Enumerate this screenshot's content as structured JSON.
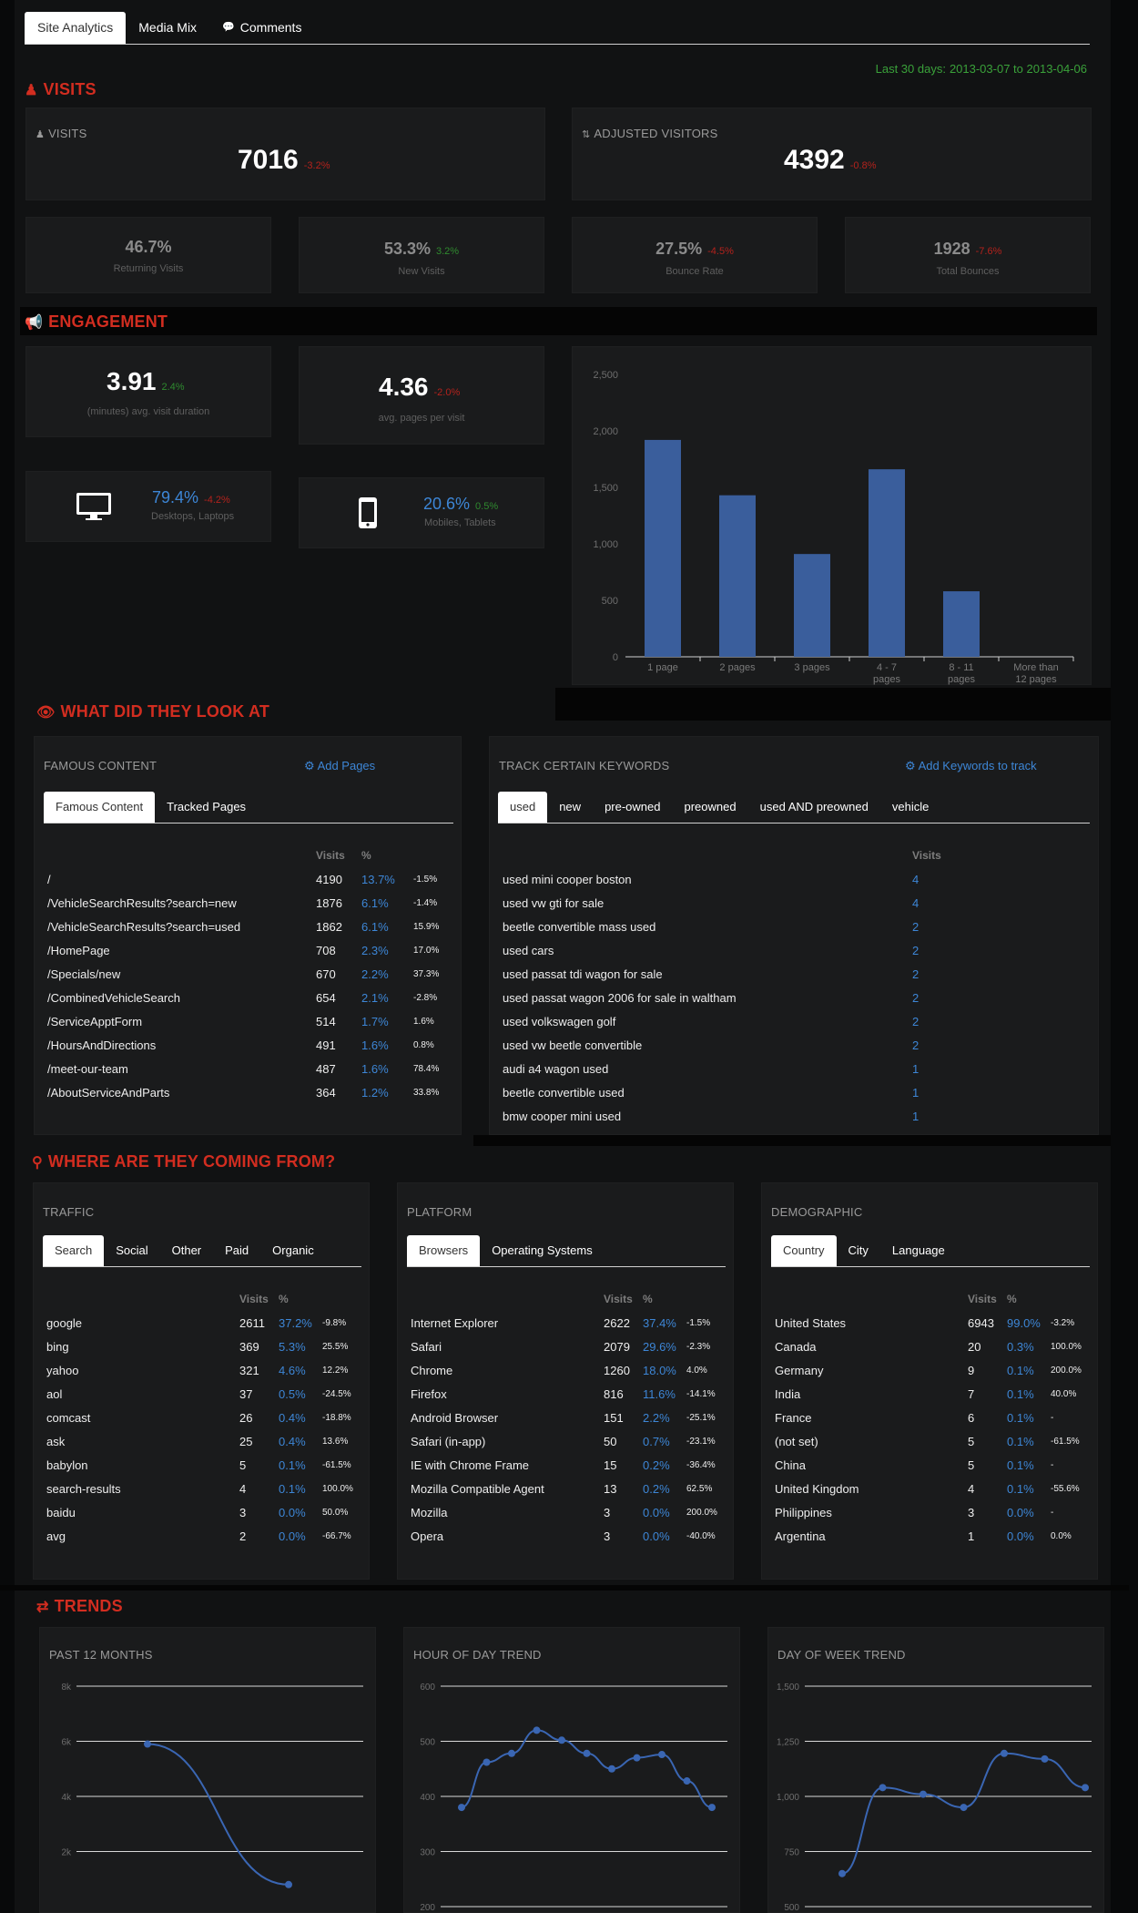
{
  "tabs": [
    "Site Analytics",
    "Media Mix",
    "Comments"
  ],
  "date_range": {
    "label": "Last 30 days:",
    "range": "2013-03-07 to 2013-04-06"
  },
  "visits": {
    "title": "VISITS",
    "visits_label": "VISITS",
    "visits_value": "7016",
    "visits_delta": "-3.2%",
    "adjusted_label": "ADJUSTED VISITORS",
    "adjusted_value": "4392",
    "adjusted_delta": "-0.8%",
    "stats": [
      {
        "value": "46.7%",
        "delta": "",
        "label": "Returning Visits",
        "tone": "neg"
      },
      {
        "value": "53.3%",
        "delta": "3.2%",
        "label": "New Visits",
        "tone": "pos"
      },
      {
        "value": "27.5%",
        "delta": "-4.5%",
        "label": "Bounce Rate",
        "tone": "neg"
      },
      {
        "value": "1928",
        "delta": "-7.6%",
        "label": "Total Bounces",
        "tone": "neg"
      }
    ]
  },
  "engagement": {
    "title": "ENGAGEMENT",
    "duration_value": "3.91",
    "duration_delta": "2.4%",
    "duration_label": "(minutes) avg. visit duration",
    "pages_value": "4.36",
    "pages_delta": "-2.0%",
    "pages_label": "avg. pages per visit",
    "desktop_value": "79.4%",
    "desktop_delta": "-4.2%",
    "desktop_label": "Desktops, Laptops",
    "mobile_value": "20.6%",
    "mobile_delta": "0.5%",
    "mobile_label": "Mobiles, Tablets",
    "desktop_icon": "monitor-icon",
    "mobile_icon": "phone-icon"
  },
  "chart_data": [
    {
      "type": "bar",
      "categories": [
        "1 page",
        "2 pages",
        "3 pages",
        "4 - 7 pages",
        "8 - 11 pages",
        "More than 12 pages"
      ],
      "category_lines": [
        [
          "1 page"
        ],
        [
          "2 pages"
        ],
        [
          "3 pages"
        ],
        [
          "4 - 7",
          "pages"
        ],
        [
          "8 - 11",
          "pages"
        ],
        [
          "More than",
          "12 pages"
        ]
      ],
      "values": [
        1920,
        1430,
        910,
        1660,
        580,
        0
      ],
      "yticks": [
        "0",
        "500",
        "1,000",
        "1,500",
        "2,000",
        "2,500"
      ],
      "ylim": [
        0,
        2500
      ],
      "title": "",
      "xlabel": "",
      "ylabel": "",
      "grid": false,
      "color": "#3a5e9c"
    },
    {
      "type": "line",
      "title": "PAST 12 MONTHS",
      "x": [
        1,
        2
      ],
      "values": [
        5900,
        800
      ],
      "yticks": [
        "2k",
        "4k",
        "6k",
        "8k"
      ],
      "ylim": [
        0,
        8000
      ],
      "grid": true
    },
    {
      "type": "line",
      "title": "HOUR OF DAY TREND",
      "values": [
        380,
        462,
        478,
        520,
        502,
        478,
        450,
        470,
        476,
        428,
        380
      ],
      "yticks": [
        "200",
        "300",
        "400",
        "500",
        "600"
      ],
      "ylim": [
        200,
        600
      ],
      "grid": true
    },
    {
      "type": "line",
      "title": "DAY OF WEEK TREND",
      "values": [
        650,
        1040,
        1010,
        950,
        1195,
        1170,
        1040
      ],
      "yticks": [
        "500",
        "750",
        "1,000",
        "1,250",
        "1,500"
      ],
      "ylim": [
        500,
        1500
      ],
      "grid": true
    }
  ],
  "look": {
    "title": "WHAT DID THEY LOOK AT",
    "famous": {
      "title": "FAMOUS CONTENT",
      "add_label": "Add Pages",
      "tabs": [
        "Famous Content",
        "Tracked Pages"
      ],
      "headers": [
        "Visits",
        "%"
      ],
      "rows": [
        {
          "page": "/",
          "visits": "4190",
          "pct": "13.7%",
          "delta": "-1.5%",
          "tone": "neg"
        },
        {
          "page": "/VehicleSearchResults?search=new",
          "visits": "1876",
          "pct": "6.1%",
          "delta": "-1.4%",
          "tone": "neg"
        },
        {
          "page": "/VehicleSearchResults?search=used",
          "visits": "1862",
          "pct": "6.1%",
          "delta": "15.9%",
          "tone": "pos"
        },
        {
          "page": "/HomePage",
          "visits": "708",
          "pct": "2.3%",
          "delta": "17.0%",
          "tone": "pos"
        },
        {
          "page": "/Specials/new",
          "visits": "670",
          "pct": "2.2%",
          "delta": "37.3%",
          "tone": "pos"
        },
        {
          "page": "/CombinedVehicleSearch",
          "visits": "654",
          "pct": "2.1%",
          "delta": "-2.8%",
          "tone": "neg"
        },
        {
          "page": "/ServiceApptForm",
          "visits": "514",
          "pct": "1.7%",
          "delta": "1.6%",
          "tone": "pos"
        },
        {
          "page": "/HoursAndDirections",
          "visits": "491",
          "pct": "1.6%",
          "delta": "0.8%",
          "tone": "pos"
        },
        {
          "page": "/meet-our-team",
          "visits": "487",
          "pct": "1.6%",
          "delta": "78.4%",
          "tone": "pos"
        },
        {
          "page": "/AboutServiceAndParts",
          "visits": "364",
          "pct": "1.2%",
          "delta": "33.8%",
          "tone": "pos"
        }
      ]
    },
    "keywords": {
      "title": "TRACK CERTAIN KEYWORDS",
      "add_label": "Add Keywords to track",
      "tabs": [
        "used",
        "new",
        "pre-owned",
        "preowned",
        "used AND preowned",
        "vehicle"
      ],
      "header": "Visits",
      "rows": [
        {
          "kw": "used mini cooper boston",
          "visits": "4"
        },
        {
          "kw": "used vw gti for sale",
          "visits": "4"
        },
        {
          "kw": "beetle convertible mass used",
          "visits": "2"
        },
        {
          "kw": "used cars",
          "visits": "2"
        },
        {
          "kw": "used passat tdi wagon for sale",
          "visits": "2"
        },
        {
          "kw": "used passat wagon 2006 for sale in waltham",
          "visits": "2"
        },
        {
          "kw": "used volkswagen golf",
          "visits": "2"
        },
        {
          "kw": "used vw beetle convertible",
          "visits": "2"
        },
        {
          "kw": "audi a4 wagon used",
          "visits": "1"
        },
        {
          "kw": "beetle convertible used",
          "visits": "1"
        },
        {
          "kw": "bmw cooper mini used",
          "visits": "1"
        }
      ]
    }
  },
  "coming": {
    "title": "WHERE ARE THEY COMING FROM?",
    "traffic": {
      "title": "TRAFFIC",
      "tabs": [
        "Search",
        "Social",
        "Other",
        "Paid",
        "Organic"
      ],
      "headers": [
        "Visits",
        "%"
      ],
      "rows": [
        {
          "name": "google",
          "visits": "2611",
          "pct": "37.2%",
          "delta": "-9.8%",
          "tone": "neg"
        },
        {
          "name": "bing",
          "visits": "369",
          "pct": "5.3%",
          "delta": "25.5%",
          "tone": "pos"
        },
        {
          "name": "yahoo",
          "visits": "321",
          "pct": "4.6%",
          "delta": "12.2%",
          "tone": "pos"
        },
        {
          "name": "aol",
          "visits": "37",
          "pct": "0.5%",
          "delta": "-24.5%",
          "tone": "neg"
        },
        {
          "name": "comcast",
          "visits": "26",
          "pct": "0.4%",
          "delta": "-18.8%",
          "tone": "neg"
        },
        {
          "name": "ask",
          "visits": "25",
          "pct": "0.4%",
          "delta": "13.6%",
          "tone": "pos"
        },
        {
          "name": "babylon",
          "visits": "5",
          "pct": "0.1%",
          "delta": "-61.5%",
          "tone": "neg"
        },
        {
          "name": "search-results",
          "visits": "4",
          "pct": "0.1%",
          "delta": "100.0%",
          "tone": "pos"
        },
        {
          "name": "baidu",
          "visits": "3",
          "pct": "0.0%",
          "delta": "50.0%",
          "tone": "pos"
        },
        {
          "name": "avg",
          "visits": "2",
          "pct": "0.0%",
          "delta": "-66.7%",
          "tone": "neg"
        }
      ]
    },
    "platform": {
      "title": "PLATFORM",
      "tabs": [
        "Browsers",
        "Operating Systems"
      ],
      "headers": [
        "Visits",
        "%"
      ],
      "rows": [
        {
          "name": "Internet Explorer",
          "visits": "2622",
          "pct": "37.4%",
          "delta": "-1.5%",
          "tone": "neg"
        },
        {
          "name": "Safari",
          "visits": "2079",
          "pct": "29.6%",
          "delta": "-2.3%",
          "tone": "neg"
        },
        {
          "name": "Chrome",
          "visits": "1260",
          "pct": "18.0%",
          "delta": "4.0%",
          "tone": "pos"
        },
        {
          "name": "Firefox",
          "visits": "816",
          "pct": "11.6%",
          "delta": "-14.1%",
          "tone": "neg"
        },
        {
          "name": "Android Browser",
          "visits": "151",
          "pct": "2.2%",
          "delta": "-25.1%",
          "tone": "neg"
        },
        {
          "name": "Safari (in-app)",
          "visits": "50",
          "pct": "0.7%",
          "delta": "-23.1%",
          "tone": "neg"
        },
        {
          "name": "IE with Chrome Frame",
          "visits": "15",
          "pct": "0.2%",
          "delta": "-36.4%",
          "tone": "pos"
        },
        {
          "name": "Mozilla Compatible Agent",
          "visits": "13",
          "pct": "0.2%",
          "delta": "62.5%",
          "tone": "pos"
        },
        {
          "name": "Mozilla",
          "visits": "3",
          "pct": "0.0%",
          "delta": "200.0%",
          "tone": "pos"
        },
        {
          "name": "Opera",
          "visits": "3",
          "pct": "0.0%",
          "delta": "-40.0%",
          "tone": "neg"
        }
      ]
    },
    "demographic": {
      "title": "DEMOGRAPHIC",
      "tabs": [
        "Country",
        "City",
        "Language"
      ],
      "headers": [
        "Visits",
        "%"
      ],
      "rows": [
        {
          "name": "United States",
          "visits": "6943",
          "pct": "99.0%",
          "delta": "-3.2%",
          "tone": "neg"
        },
        {
          "name": "Canada",
          "visits": "20",
          "pct": "0.3%",
          "delta": "100.0%",
          "tone": "pos"
        },
        {
          "name": "Germany",
          "visits": "9",
          "pct": "0.1%",
          "delta": "200.0%",
          "tone": "pos"
        },
        {
          "name": "India",
          "visits": "7",
          "pct": "0.1%",
          "delta": "40.0%",
          "tone": "pos"
        },
        {
          "name": "France",
          "visits": "6",
          "pct": "0.1%",
          "delta": "-",
          "tone": "pos"
        },
        {
          "name": "(not set)",
          "visits": "5",
          "pct": "0.1%",
          "delta": "-61.5%",
          "tone": "neg"
        },
        {
          "name": "China",
          "visits": "5",
          "pct": "0.1%",
          "delta": "-",
          "tone": "pos"
        },
        {
          "name": "United Kingdom",
          "visits": "4",
          "pct": "0.1%",
          "delta": "-55.6%",
          "tone": "neg"
        },
        {
          "name": "Philippines",
          "visits": "3",
          "pct": "0.0%",
          "delta": "-",
          "tone": "pos"
        },
        {
          "name": "Argentina",
          "visits": "1",
          "pct": "0.0%",
          "delta": "0.0%",
          "tone": "neu"
        }
      ]
    }
  },
  "trends": {
    "title": "TRENDS"
  },
  "colors": {
    "accent_red": "#d22d20",
    "link_blue": "#3d86d6",
    "bar_blue": "#3a5e9c"
  }
}
